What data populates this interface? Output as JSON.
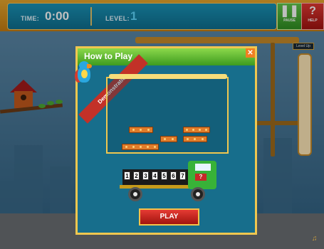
{
  "hud": {
    "time_label": "TIME:",
    "time_value": "0:00",
    "level_label": "LEVEL:",
    "level_value": "1",
    "pause_label": "PAUSE",
    "help_label": "HELP",
    "pause_icon": "pause-icon",
    "help_icon": "question-icon"
  },
  "scene": {
    "level_up_label": "Level Up"
  },
  "modal": {
    "title": "How to Play",
    "close_icon": "close-icon",
    "ribbon": "Demonstration",
    "truck_numbers": [
      "1",
      "2",
      "3",
      "4",
      "5",
      "6",
      "7"
    ],
    "truck_sign": "?",
    "play_label": "PLAY"
  },
  "colors": {
    "hud_bg": "#1689ad",
    "accent": "#f0c74f",
    "pause": "#3fa12c",
    "help": "#c71f19",
    "play": "#d12a23",
    "header": "#6cc23a"
  }
}
